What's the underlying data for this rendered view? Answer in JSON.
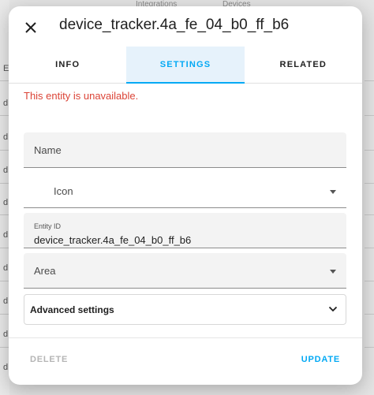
{
  "dialog": {
    "title": "device_tracker.4a_fe_04_b0_ff_b6",
    "close_icon": "close-icon"
  },
  "tabs": [
    {
      "label": "INFO",
      "active": false
    },
    {
      "label": "SETTINGS",
      "active": true
    },
    {
      "label": "RELATED",
      "active": false
    }
  ],
  "status": {
    "message": "This entity is unavailable.",
    "color": "#db4437"
  },
  "form": {
    "name": {
      "label": "Name",
      "value": ""
    },
    "icon": {
      "label": "Icon",
      "value": ""
    },
    "entity_id": {
      "label": "Entity ID",
      "value": "device_tracker.4a_fe_04_b0_ff_b6"
    },
    "area": {
      "label": "Area",
      "value": ""
    },
    "advanced": {
      "label": "Advanced settings",
      "expanded": false
    }
  },
  "footer": {
    "delete_label": "DELETE",
    "update_label": "UPDATE"
  },
  "background": {
    "left_letters": [
      "E",
      "d",
      "d",
      "d",
      "d",
      "d",
      "d",
      "d",
      "d",
      "d",
      "d"
    ],
    "top_texts": [
      "Integrations",
      "Devices"
    ]
  },
  "colors": {
    "accent": "#03a9f4",
    "active_tab_bg": "#e6f2fb",
    "disabled": "#b5b5b5"
  }
}
